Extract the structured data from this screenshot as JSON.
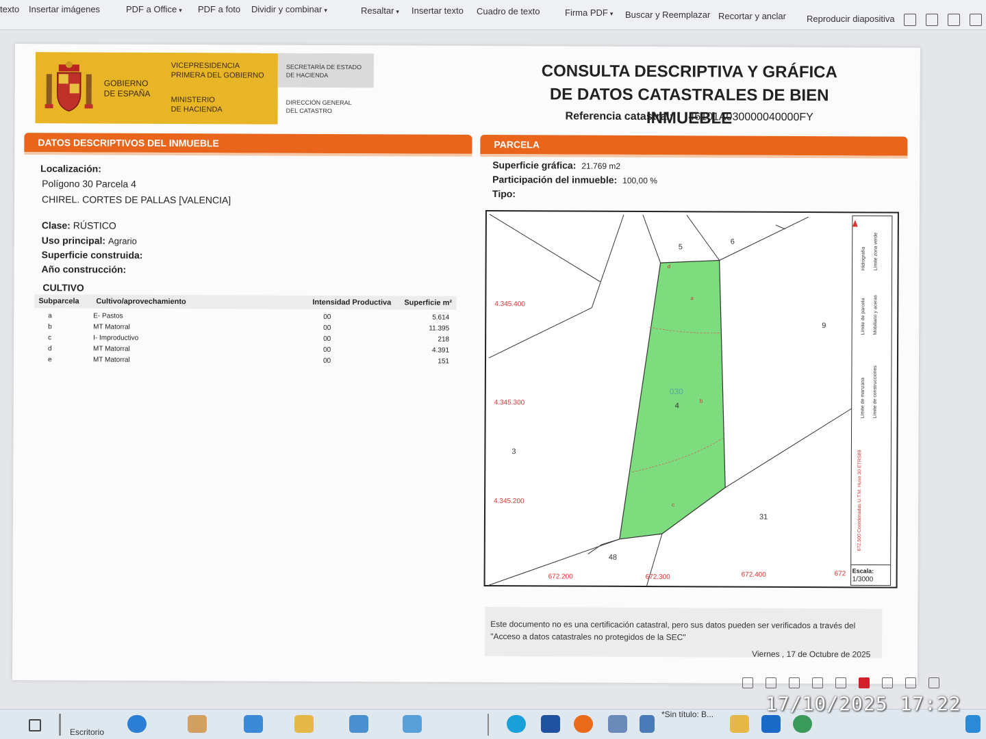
{
  "toolbar": {
    "items": [
      {
        "label": "texto",
        "dropdown": false
      },
      {
        "label": "Insertar imágenes",
        "dropdown": false
      },
      {
        "label": "PDF a Office",
        "dropdown": true
      },
      {
        "label": "PDF a foto",
        "dropdown": false
      },
      {
        "label": "Dividir y combinar",
        "dropdown": true
      },
      {
        "label": "Resaltar",
        "dropdown": true
      },
      {
        "label": "Insertar texto",
        "dropdown": false
      },
      {
        "label": "Cuadro de texto",
        "dropdown": false
      },
      {
        "label": "Firma PDF",
        "dropdown": true
      },
      {
        "label": "Buscar y Reemplazar",
        "dropdown": false
      },
      {
        "label": "Recortar y anclar",
        "dropdown": false
      },
      {
        "label": "Reproducir diapositiva",
        "dropdown": false
      }
    ]
  },
  "header": {
    "gov_line1": "GOBIERNO",
    "gov_line2": "DE ESPAÑA",
    "vp_line1": "VICEPRESIDENCIA",
    "vp_line2": "PRIMERA DEL GOBIERNO",
    "min_line1": "MINISTERIO",
    "min_line2": "DE HACIENDA",
    "sec_line1": "SECRETARÍA DE ESTADO",
    "sec_line2": "DE HACIENDA",
    "dir_line1": "DIRECCIÓN GENERAL",
    "dir_line2": "DEL CATASTRO",
    "title_line1": "CONSULTA DESCRIPTIVA Y GRÁFICA",
    "title_line2": "DE DATOS CATASTRALES DE BIEN INMUEBLE",
    "ref_label": "Referencia catastral:",
    "ref_value": "46101A030000040000FY"
  },
  "left": {
    "section_title": "DATOS DESCRIPTIVOS DEL INMUEBLE",
    "loc_label": "Localización:",
    "loc_line1": "Polígono 30 Parcela 4",
    "loc_line2": "CHIREL. CORTES DE PALLAS [VALENCIA]",
    "clase_label": "Clase:",
    "clase_value": "RÚSTICO",
    "uso_label": "Uso principal:",
    "uso_value": "Agrario",
    "sup_label": "Superficie construida:",
    "anio_label": "Año construcción:",
    "cultivo_title": "CULTIVO",
    "cultivo_headers": [
      "Subparcela",
      "Cultivo/aprovechamiento",
      "Intensidad Productiva",
      "Superficie m²"
    ],
    "cultivo_rows": [
      [
        "a",
        "E- Pastos",
        "00",
        "5.614"
      ],
      [
        "b",
        "MT Matorral",
        "00",
        "11.395"
      ],
      [
        "c",
        "I- Improductivo",
        "00",
        "218"
      ],
      [
        "d",
        "MT Matorral",
        "00",
        "4.391"
      ],
      [
        "e",
        "MT Matorral",
        "00",
        "151"
      ]
    ]
  },
  "right": {
    "section_title": "PARCELA",
    "sup_graf_label": "Superficie gráfica:",
    "sup_graf_value": "21.769 m2",
    "part_label": "Participación del inmueble:",
    "part_value": "100,00 %",
    "tipo_label": "Tipo:"
  },
  "map": {
    "parcel_color": "#7ddc7d",
    "y_coords": [
      "4.345.400",
      "4.345.300",
      "4.345.200"
    ],
    "x_coords": [
      "672.200",
      "672.300",
      "672.400",
      "672"
    ],
    "parcel_numbers": [
      "5",
      "6",
      "9",
      "3",
      "31",
      "48",
      "4"
    ],
    "poligono": "030",
    "subparcel_letters": [
      "a",
      "b",
      "c",
      "d"
    ],
    "legend": [
      "Límite de manzana",
      "Límite de parcela",
      "Hidrografía",
      "Límite de construcciones",
      "Mobiliario y aceras",
      "Límite zona verde"
    ],
    "utm_note": "672.500 Coordenadas U.T.M. Huso 30 ETRS89",
    "scale_label": "Escala:",
    "scale_value": "1/3000"
  },
  "footer": {
    "notice": "Este documento no es una certificación catastral, pero sus datos pueden ser verificados a través del \"Acceso a datos catastrales no protegidos de la SEC\"",
    "date": "Viernes , 17 de Octubre de 2025"
  },
  "taskbar": {
    "desktop_label": "Escritorio",
    "paint_label": "*Sin título: B...",
    "timestamp": "17/10/2025 17:22"
  }
}
